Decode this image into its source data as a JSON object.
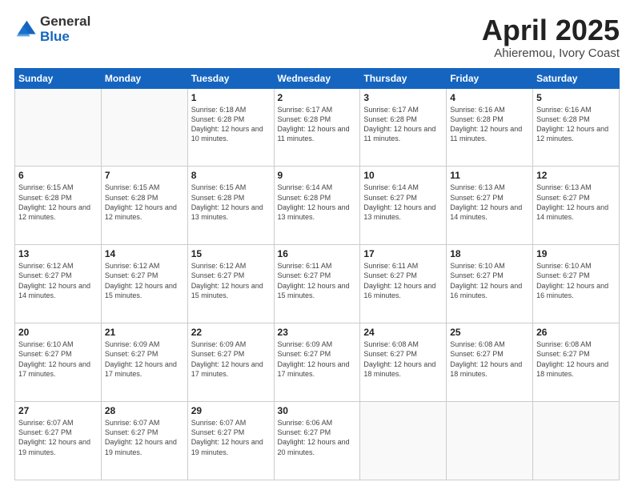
{
  "logo": {
    "general": "General",
    "blue": "Blue"
  },
  "title": {
    "month_year": "April 2025",
    "location": "Ahieremou, Ivory Coast"
  },
  "weekdays": [
    "Sunday",
    "Monday",
    "Tuesday",
    "Wednesday",
    "Thursday",
    "Friday",
    "Saturday"
  ],
  "weeks": [
    [
      {
        "day": null,
        "info": null
      },
      {
        "day": null,
        "info": null
      },
      {
        "day": "1",
        "info": "Sunrise: 6:18 AM\nSunset: 6:28 PM\nDaylight: 12 hours and 10 minutes."
      },
      {
        "day": "2",
        "info": "Sunrise: 6:17 AM\nSunset: 6:28 PM\nDaylight: 12 hours and 11 minutes."
      },
      {
        "day": "3",
        "info": "Sunrise: 6:17 AM\nSunset: 6:28 PM\nDaylight: 12 hours and 11 minutes."
      },
      {
        "day": "4",
        "info": "Sunrise: 6:16 AM\nSunset: 6:28 PM\nDaylight: 12 hours and 11 minutes."
      },
      {
        "day": "5",
        "info": "Sunrise: 6:16 AM\nSunset: 6:28 PM\nDaylight: 12 hours and 12 minutes."
      }
    ],
    [
      {
        "day": "6",
        "info": "Sunrise: 6:15 AM\nSunset: 6:28 PM\nDaylight: 12 hours and 12 minutes."
      },
      {
        "day": "7",
        "info": "Sunrise: 6:15 AM\nSunset: 6:28 PM\nDaylight: 12 hours and 12 minutes."
      },
      {
        "day": "8",
        "info": "Sunrise: 6:15 AM\nSunset: 6:28 PM\nDaylight: 12 hours and 13 minutes."
      },
      {
        "day": "9",
        "info": "Sunrise: 6:14 AM\nSunset: 6:28 PM\nDaylight: 12 hours and 13 minutes."
      },
      {
        "day": "10",
        "info": "Sunrise: 6:14 AM\nSunset: 6:27 PM\nDaylight: 12 hours and 13 minutes."
      },
      {
        "day": "11",
        "info": "Sunrise: 6:13 AM\nSunset: 6:27 PM\nDaylight: 12 hours and 14 minutes."
      },
      {
        "day": "12",
        "info": "Sunrise: 6:13 AM\nSunset: 6:27 PM\nDaylight: 12 hours and 14 minutes."
      }
    ],
    [
      {
        "day": "13",
        "info": "Sunrise: 6:12 AM\nSunset: 6:27 PM\nDaylight: 12 hours and 14 minutes."
      },
      {
        "day": "14",
        "info": "Sunrise: 6:12 AM\nSunset: 6:27 PM\nDaylight: 12 hours and 15 minutes."
      },
      {
        "day": "15",
        "info": "Sunrise: 6:12 AM\nSunset: 6:27 PM\nDaylight: 12 hours and 15 minutes."
      },
      {
        "day": "16",
        "info": "Sunrise: 6:11 AM\nSunset: 6:27 PM\nDaylight: 12 hours and 15 minutes."
      },
      {
        "day": "17",
        "info": "Sunrise: 6:11 AM\nSunset: 6:27 PM\nDaylight: 12 hours and 16 minutes."
      },
      {
        "day": "18",
        "info": "Sunrise: 6:10 AM\nSunset: 6:27 PM\nDaylight: 12 hours and 16 minutes."
      },
      {
        "day": "19",
        "info": "Sunrise: 6:10 AM\nSunset: 6:27 PM\nDaylight: 12 hours and 16 minutes."
      }
    ],
    [
      {
        "day": "20",
        "info": "Sunrise: 6:10 AM\nSunset: 6:27 PM\nDaylight: 12 hours and 17 minutes."
      },
      {
        "day": "21",
        "info": "Sunrise: 6:09 AM\nSunset: 6:27 PM\nDaylight: 12 hours and 17 minutes."
      },
      {
        "day": "22",
        "info": "Sunrise: 6:09 AM\nSunset: 6:27 PM\nDaylight: 12 hours and 17 minutes."
      },
      {
        "day": "23",
        "info": "Sunrise: 6:09 AM\nSunset: 6:27 PM\nDaylight: 12 hours and 17 minutes."
      },
      {
        "day": "24",
        "info": "Sunrise: 6:08 AM\nSunset: 6:27 PM\nDaylight: 12 hours and 18 minutes."
      },
      {
        "day": "25",
        "info": "Sunrise: 6:08 AM\nSunset: 6:27 PM\nDaylight: 12 hours and 18 minutes."
      },
      {
        "day": "26",
        "info": "Sunrise: 6:08 AM\nSunset: 6:27 PM\nDaylight: 12 hours and 18 minutes."
      }
    ],
    [
      {
        "day": "27",
        "info": "Sunrise: 6:07 AM\nSunset: 6:27 PM\nDaylight: 12 hours and 19 minutes."
      },
      {
        "day": "28",
        "info": "Sunrise: 6:07 AM\nSunset: 6:27 PM\nDaylight: 12 hours and 19 minutes."
      },
      {
        "day": "29",
        "info": "Sunrise: 6:07 AM\nSunset: 6:27 PM\nDaylight: 12 hours and 19 minutes."
      },
      {
        "day": "30",
        "info": "Sunrise: 6:06 AM\nSunset: 6:27 PM\nDaylight: 12 hours and 20 minutes."
      },
      {
        "day": null,
        "info": null
      },
      {
        "day": null,
        "info": null
      },
      {
        "day": null,
        "info": null
      }
    ]
  ]
}
